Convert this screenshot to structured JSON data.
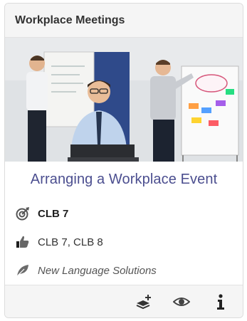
{
  "card": {
    "header_title": "Workplace Meetings",
    "title": "Arranging a Workplace Event",
    "level": {
      "icon": "target-arrow-icon",
      "label": "CLB 7"
    },
    "recommended": {
      "icon": "thumbs-up-icon",
      "label": "CLB 7, CLB 8"
    },
    "source": {
      "icon": "leaf-icon",
      "label": "New Language Solutions"
    },
    "footer": {
      "add_icon": "add-to-stack-icon",
      "view_icon": "eye-icon",
      "info_icon": "info-icon"
    }
  },
  "colors": {
    "title": "#4b4e8f",
    "header_bg": "#f5f5f5",
    "border": "#dcdcdc"
  }
}
